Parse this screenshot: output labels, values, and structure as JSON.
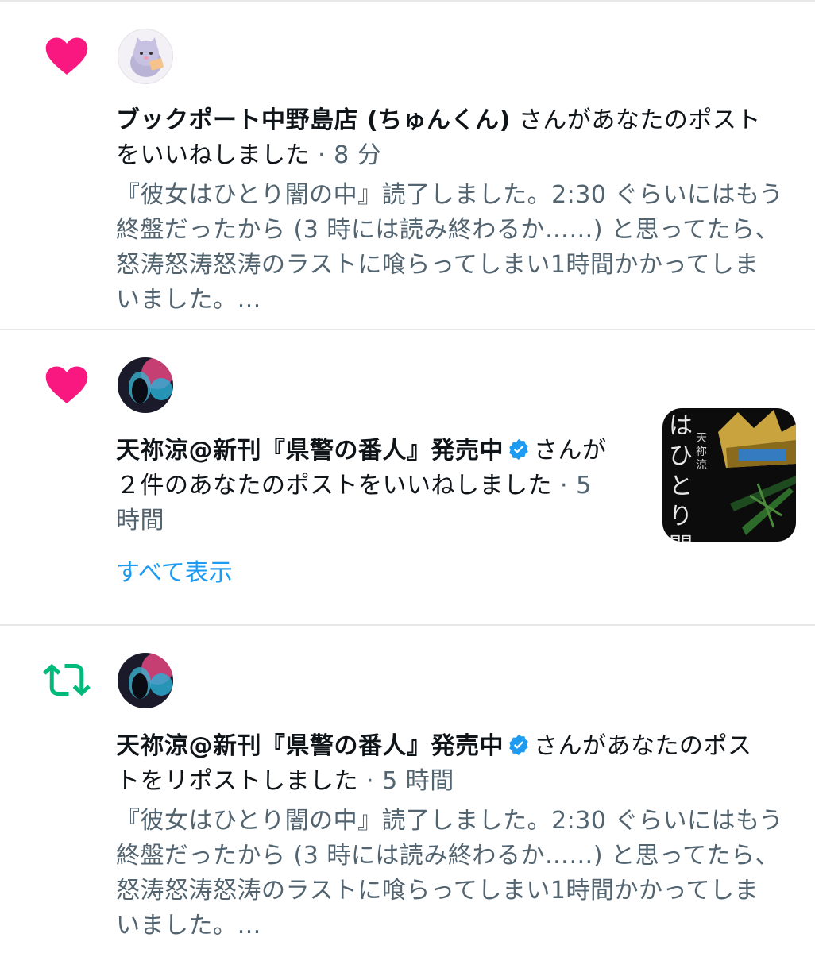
{
  "notifications": [
    {
      "type": "like",
      "icon": "heart-icon",
      "icon_color": "#f91880",
      "user_name": "ブックポート中野島店 (ちゅんくん)",
      "verified": false,
      "action": " さんがあなたのポスト",
      "action_line2": "をいいねしました",
      "separator": " · ",
      "time": "8 分",
      "preview_lines": [
        "『彼女はひとり闇の中』読了しました。2:30 ぐらいにはもう",
        "終盤だったから (3 時には読み終わるか……) と思ってたら、",
        "怒涛怒涛怒涛のラストに喰らってしまい1時間かかってしま",
        "いました。…"
      ]
    },
    {
      "type": "like",
      "icon": "heart-icon",
      "icon_color": "#f91880",
      "user_name": "天祢涼@新刊『県警の番人』発売中",
      "verified": true,
      "action": "さんが",
      "action_line2": "２件のあなたのポストをいいねしました",
      "separator": " · ",
      "time_part1": "5",
      "time_part2": "時間",
      "show_all": "すべて表示",
      "thumbnail_text": "はひとり闇の",
      "thumbnail_author": "天祢 涼"
    },
    {
      "type": "repost",
      "icon": "repost-icon",
      "icon_color": "#00ba7c",
      "user_name": "天祢涼@新刊『県警の番人』発売中",
      "verified": true,
      "action": "さんがあなたのポス",
      "action_line2": "トをリポストしました",
      "separator": " · ",
      "time": "5 時間",
      "preview_lines": [
        "『彼女はひとり闇の中』読了しました。2:30 ぐらいにはもう",
        "終盤だったから (3 時には読み終わるか……) と思ってたら、",
        "怒涛怒涛怒涛のラストに喰らってしまい1時間かかってしま",
        "いました。…"
      ]
    }
  ],
  "colors": {
    "like": "#f91880",
    "repost": "#00ba7c",
    "link": "#1d9bf0",
    "verified": "#1d9bf0",
    "secondary_text": "#536471"
  }
}
